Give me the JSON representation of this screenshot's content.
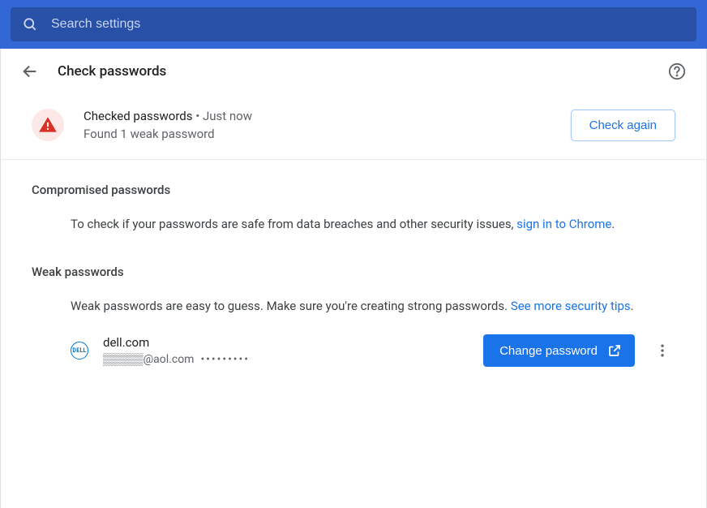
{
  "search": {
    "placeholder": "Search settings"
  },
  "header": {
    "title": "Check passwords"
  },
  "status": {
    "title": "Checked passwords",
    "time": "Just now",
    "subtitle": "Found 1 weak password",
    "button": "Check again"
  },
  "compromised": {
    "title": "Compromised passwords",
    "text_before": "To check if your passwords are safe from data breaches and other security issues, ",
    "link": "sign in to Chrome",
    "text_after": "."
  },
  "weak": {
    "title": "Weak passwords",
    "text_before": "Weak passwords are easy to guess. Make sure you're creating strong passwords. ",
    "link": "See more security tips",
    "text_after": ".",
    "item": {
      "icon_label": "DELL",
      "domain": "dell.com",
      "username_obscured": "▒▒▒▒▒@aol.com",
      "password_mask": "•••••••••",
      "change_button": "Change password"
    }
  }
}
